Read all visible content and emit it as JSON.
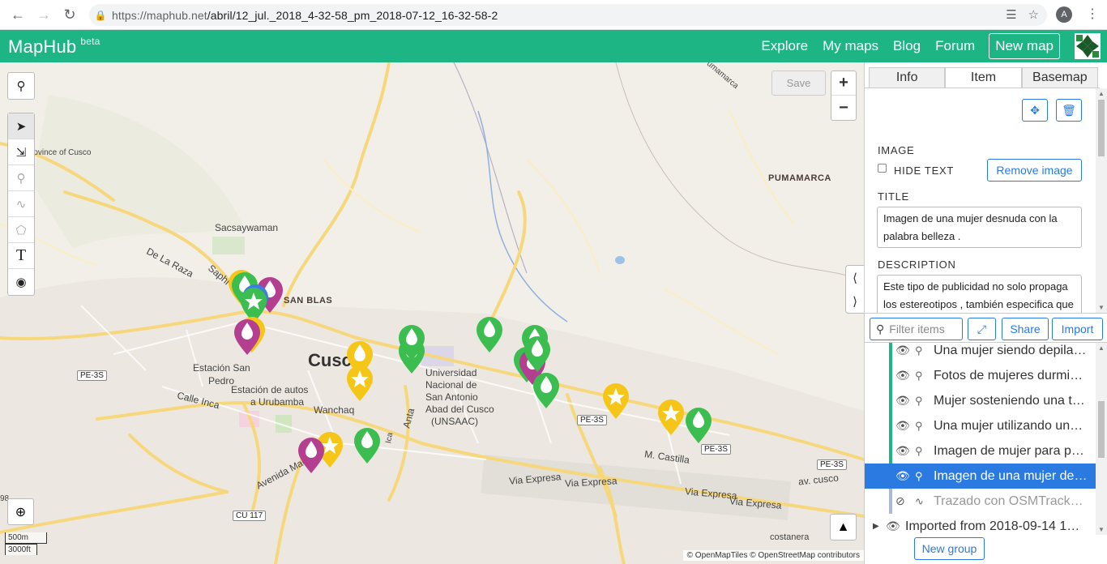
{
  "browser": {
    "url_host": "https://maphub.net",
    "url_path": "/abril/12_jul._2018_4-32-58_pm_2018-07-12_16-32-58-2",
    "avatar_letter": "A"
  },
  "header": {
    "brand": "MapHub",
    "brand_tag": "beta",
    "nav": [
      "Explore",
      "My maps",
      "Blog",
      "Forum"
    ],
    "new_map": "New map",
    "accent": "#1eb584"
  },
  "map": {
    "save": "Save",
    "zoom_in": "+",
    "zoom_out": "−",
    "scale_m": "500m",
    "scale_ft": "3000ft",
    "attribution": "© OpenMapTiles © OpenStreetMap contributors",
    "labels": {
      "province": "rovince of Cusco",
      "sacsaywaman": "Sacsaywaman",
      "san_blas": "SAN BLAS",
      "cusco": "Cusco",
      "pumamarca": "PUMAMARCA",
      "pumamarca_road": "Pumamarca",
      "estacion_san_pedro_1": "Estación San",
      "estacion_san_pedro_2": "Pedro",
      "estacion_autos_1": "Estación de autos",
      "estacion_autos_2": "a Urubamba",
      "wanchaq": "Wanchaq",
      "uni_1": "Universidad",
      "uni_2": "Nacional de",
      "uni_3": "San Antonio",
      "uni_4": "Abad del Cusco",
      "uni_5": "(UNSAAC)",
      "calle_inca": "Calle Inca",
      "avenida_mac": "Avenida Mac",
      "via_expresa_1": "Via Expresa",
      "via_expresa_2": "Via Expresa",
      "via_expresa_3": "Via Expresa",
      "via_expresa_4": "Via Expresa",
      "m_castilla": "M. Castilla",
      "av_cusco": "av. cusco",
      "costanera": "costanera",
      "de_la_raza": "De La Raza",
      "saphi": "Saphi",
      "anta": "Anta",
      "ica": "Ica",
      "left_edge": "98"
    },
    "shields": [
      "PE-3S",
      "PE-3S",
      "PE-3S",
      "PE-3S",
      "CU 117"
    ]
  },
  "panel": {
    "tabs": [
      "Info",
      "Item",
      "Basemap"
    ],
    "active_tab": "Item",
    "image_label": "IMAGE",
    "hide_text": "HIDE TEXT",
    "remove_image": "Remove image",
    "title_label": "TITLE",
    "title_value": "Imagen de una mujer desnuda  con la palabra belleza .",
    "description_label": "DESCRIPTION",
    "description_value": "Este tipo de publicidad no solo propaga los estereotipos , también especifica que existe una sola forma de representar belleza física",
    "filter_placeholder": "Filter items",
    "share": "Share",
    "import": "Import",
    "items": [
      {
        "label": "Una mujer siendo depila…",
        "state": "normal"
      },
      {
        "label": "Fotos de mujeres durmi…",
        "state": "normal"
      },
      {
        "label": "Mujer sosteniendo una t…",
        "state": "normal"
      },
      {
        "label": "Una mujer utilizando un…",
        "state": "normal"
      },
      {
        "label": "Imagen de mujer para p…",
        "state": "normal"
      },
      {
        "label": "Imagen de una mujer de…",
        "state": "selected"
      },
      {
        "label": "Trazado con OSMTrack…",
        "state": "hidden"
      }
    ],
    "group": "Imported from 2018-09-14  1…",
    "new_group": "New group"
  }
}
